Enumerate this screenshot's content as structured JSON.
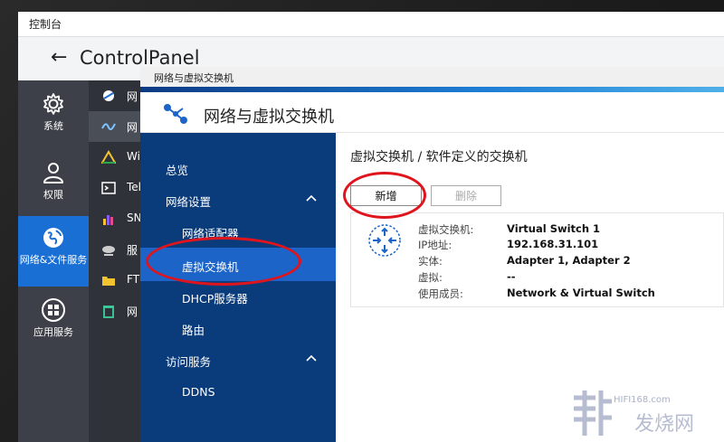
{
  "cp": {
    "titlebar": "控制台",
    "title": "ControlPanel"
  },
  "sidebar": {
    "items": [
      {
        "label": "系统",
        "icon": "gear-icon"
      },
      {
        "label": "权限",
        "icon": "user-icon"
      },
      {
        "label": "网络&文件服务",
        "icon": "globe-icon"
      },
      {
        "label": "应用服务",
        "icon": "grid-icon"
      }
    ]
  },
  "subnav": {
    "items": [
      {
        "label": "网",
        "icon": "network-icon"
      },
      {
        "label": "网",
        "icon": "wave-icon"
      },
      {
        "label": "Wi",
        "icon": "triangle-icon"
      },
      {
        "label": "Tel",
        "icon": "terminal-icon"
      },
      {
        "label": "SN",
        "icon": "bar-chart-icon"
      },
      {
        "label": "服",
        "icon": "satellite-icon"
      },
      {
        "label": "FT",
        "icon": "folder-icon"
      },
      {
        "label": "网",
        "icon": "trash-icon"
      }
    ]
  },
  "window": {
    "titlebar": "网络与虚拟交换机",
    "header": "网络与虚拟交换机",
    "menu": {
      "overview": "总览",
      "net_settings": "网络设置",
      "adapters": "网络适配器",
      "vswitch": "虚拟交换机",
      "dhcp": "DHCP服务器",
      "route": "路由",
      "access": "访问服务",
      "ddns": "DDNS"
    },
    "content": {
      "breadcrumb": "虚拟交换机 / 软件定义的交换机",
      "add": "新增",
      "delete": "删除",
      "switch": {
        "k_name": "虚拟交换机:",
        "v_name": "Virtual Switch 1",
        "k_ip": "IP地址:",
        "v_ip": "192.168.31.101",
        "k_entity": "实体:",
        "v_entity": "Adapter 1, Adapter 2",
        "k_virtual": "虚拟:",
        "v_virtual": "--",
        "k_used": "使用成员:",
        "v_used": "Network & Virtual Switch"
      }
    }
  },
  "watermark": {
    "url": "HIFI168.com",
    "text": "发烧网"
  },
  "colors": {
    "menu_bg": "#0a3c7c",
    "menu_selected": "#1c64c8",
    "sidebar_active": "#1a6fd4",
    "highlight": "#e0141d"
  }
}
